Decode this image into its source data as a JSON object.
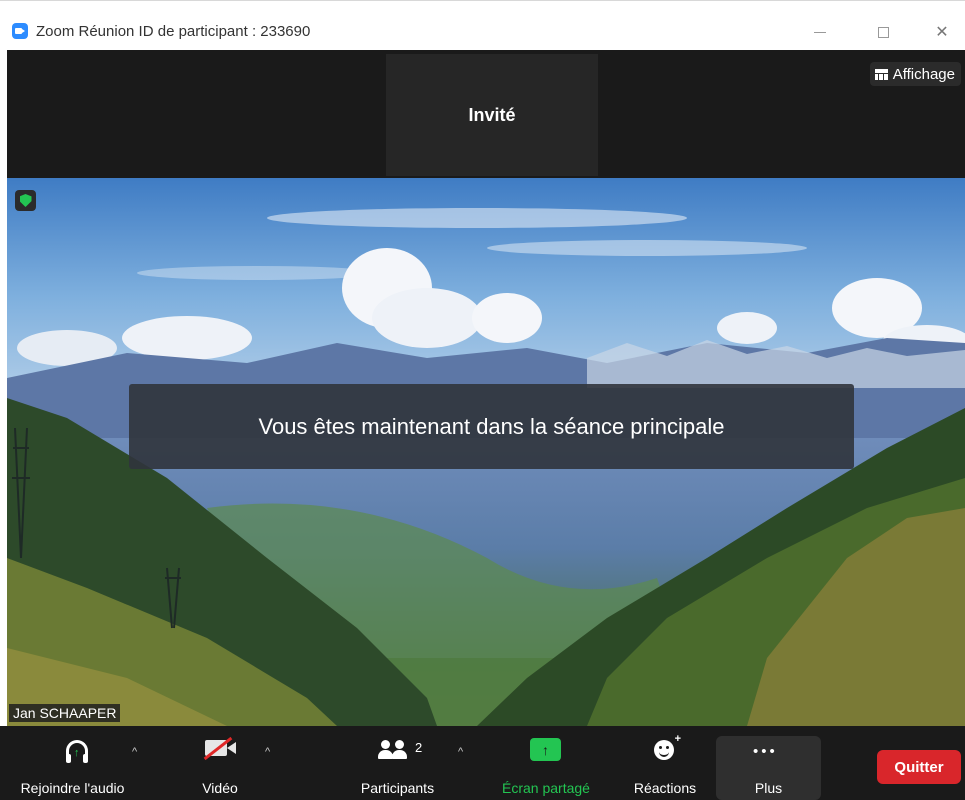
{
  "window": {
    "title": "Zoom Réunion ID de participant : 233690",
    "minimize_icon": "minimize-icon",
    "maximize_icon": "maximize-icon",
    "close_glyph": "✕"
  },
  "gallery": {
    "guest_tile_name": "Invité",
    "view_button_label": "Affichage",
    "view_icon": "gallery-view-icon"
  },
  "video": {
    "security_icon": "shield-check-icon",
    "notification": "Vous êtes maintenant dans la séance principale",
    "participant_name": "Jan SCHAAPER"
  },
  "toolbar": {
    "audio_label": "Rejoindre l'audio",
    "video_label": "Vidéo",
    "participants_label": "Participants",
    "participants_count": "2",
    "share_label": "Écran partagé",
    "reactions_label": "Réactions",
    "more_label": "Plus",
    "more_glyph": "•••",
    "quit_label": "Quitter",
    "caret_glyph": "^",
    "share_arrow": "↑",
    "audio_arrow": "↑",
    "reaction_plus": "+"
  },
  "colors": {
    "accent_green": "#23c552",
    "quit_red": "#d9262b",
    "zoom_blue": "#2d8cff",
    "toolbar_bg": "#1a1a1a"
  }
}
